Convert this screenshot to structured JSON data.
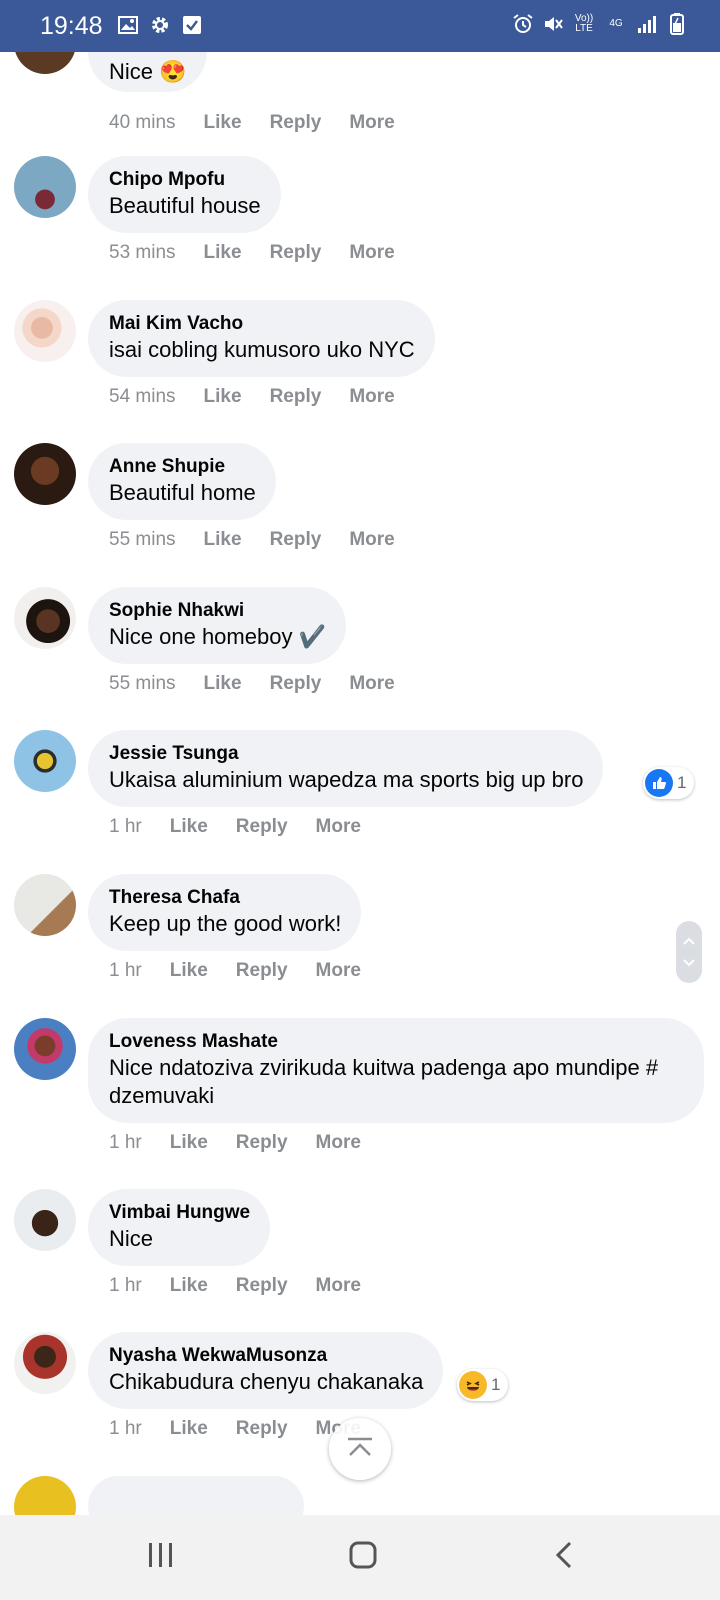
{
  "status_bar": {
    "time": "19:48",
    "left_icons": [
      "image-icon",
      "gear-icon",
      "check-box-icon"
    ],
    "right_icons": [
      "alarm-icon",
      "mute-icon",
      "volte-icon",
      "4g-icon",
      "signal-icon",
      "battery-icon"
    ],
    "volte_label": "Vo)) LTE",
    "network_label": "4G",
    "background": "#3b5998"
  },
  "top_partial": {
    "text": "Nice 😍",
    "time": "40 mins"
  },
  "actions": {
    "like": "Like",
    "reply": "Reply",
    "more": "More"
  },
  "comments": [
    {
      "name": "Chipo Mpofu",
      "text": "Beautiful house",
      "time": "53 mins"
    },
    {
      "name": "Mai Kim Vacho",
      "text": "isai cobling kumusoro uko NYC",
      "time": "54 mins"
    },
    {
      "name": "Anne Shupie",
      "text": "Beautiful home",
      "time": "55 mins"
    },
    {
      "name": "Sophie Nhakwi",
      "text": "Nice one homeboy ✔️",
      "time": "55 mins"
    },
    {
      "name": "Jessie Tsunga",
      "text": "Ukaisa aluminium wapedza ma sports big up bro",
      "time": "1 hr",
      "reaction": {
        "type": "like-icon",
        "count": "1"
      }
    },
    {
      "name": "Theresa Chafa",
      "text": "Keep up the good work!",
      "time": "1 hr"
    },
    {
      "name": "Loveness Mashate",
      "text": "Nice ndatoziva zvirikuda kuitwa padenga apo mundipe # dzemuvaki",
      "time": "1 hr"
    },
    {
      "name": "Vimbai Hungwe",
      "text": "Nice",
      "time": "1 hr"
    },
    {
      "name": "Nyasha WekwaMusonza",
      "text": "Chikabudura chenyu chakanaka",
      "time": "1 hr",
      "reaction": {
        "type": "haha-icon",
        "count": "1"
      }
    }
  ],
  "colors": {
    "bubble": "#f0f2f5",
    "secondary_text": "#8a8d91",
    "like_blue": "#1877f2"
  },
  "nav": {
    "icons": [
      "recent-apps-icon",
      "home-icon",
      "back-icon"
    ]
  }
}
